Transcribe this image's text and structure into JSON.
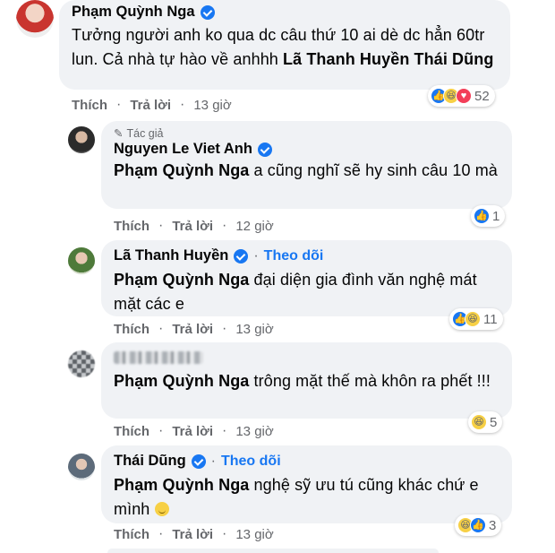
{
  "comments": [
    {
      "author": "Phạm Quỳnh Nga",
      "text_plain": "Tưởng người anh ko qua dc câu thứ 10 ai dè dc hẳn 60tr lun. Cả nhà tự hào về anhhh ",
      "text_tags": "Lã Thanh Huyền Thái Dũng",
      "action_like": "Thích",
      "action_reply": "Trả lời",
      "time": "13 giờ",
      "reaction_count": "52",
      "reactions": [
        "like-icon",
        "haha-icon",
        "love-icon"
      ]
    },
    {
      "author_badge": "Tác giả",
      "author": "Nguyen Le Viet Anh",
      "mention": "Phạm Quỳnh Nga",
      "text": " a cũng nghĩ sẽ hy sinh câu 10 mà",
      "action_like": "Thích",
      "action_reply": "Trả lời",
      "time": "12 giờ",
      "reaction_count": "1",
      "reactions": [
        "like-icon"
      ]
    },
    {
      "author": "Lã Thanh Huyền",
      "follow": "Theo dõi",
      "mention": "Phạm Quỳnh Nga",
      "text": " đại diện gia đình văn nghệ mát mặt các e",
      "action_like": "Thích",
      "action_reply": "Trả lời",
      "time": "13 giờ",
      "reaction_count": "11",
      "reactions": [
        "like-icon",
        "haha-icon"
      ]
    },
    {
      "mention": "Phạm Quỳnh Nga",
      "text": " trông mặt thế mà khôn ra phết !!!",
      "action_like": "Thích",
      "action_reply": "Trả lời",
      "time": "13 giờ",
      "reaction_count": "5",
      "reactions": [
        "haha-icon"
      ]
    },
    {
      "author": "Thái Dũng",
      "follow": "Theo dõi",
      "mention": "Phạm Quỳnh Nga",
      "text": " nghệ sỹ ưu tú cũng khác chứ e mình ",
      "action_like": "Thích",
      "action_reply": "Trả lời",
      "time": "13 giờ",
      "reaction_count": "3",
      "reactions": [
        "haha-icon",
        "like-icon"
      ]
    }
  ],
  "separator": "·",
  "colors": {
    "bubble": "#f0f2f5",
    "link": "#1877f2",
    "muted": "#65676b"
  }
}
